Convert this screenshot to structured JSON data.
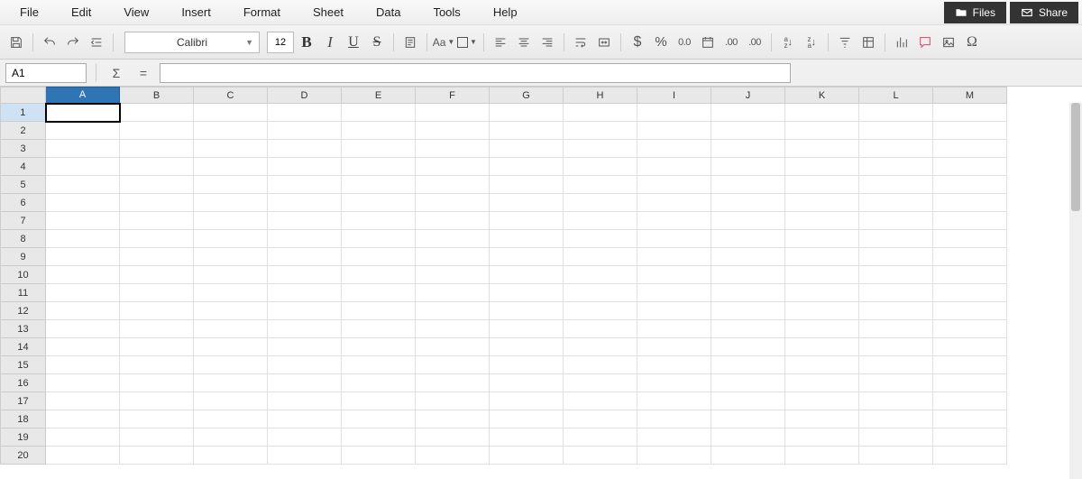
{
  "menu": {
    "items": [
      "File",
      "Edit",
      "View",
      "Insert",
      "Format",
      "Sheet",
      "Data",
      "Tools",
      "Help"
    ],
    "files_label": "Files",
    "share_label": "Share"
  },
  "toolbar": {
    "font_name": "Calibri",
    "font_size": "12",
    "bold": "B",
    "italic": "I",
    "underline": "U",
    "strike": "S",
    "aa": "Aa",
    "currency": "$",
    "percent": "%",
    "number_fmt": "0.0",
    "add_dec": ".00",
    "rem_dec": ".00",
    "sort_asc": "a↓",
    "sort_desc": "z↓",
    "omega": "Ω"
  },
  "formula": {
    "cell_ref": "A1",
    "sigma": "Σ",
    "equals": "=",
    "input": ""
  },
  "grid": {
    "columns": [
      "A",
      "B",
      "C",
      "D",
      "E",
      "F",
      "G",
      "H",
      "I",
      "J",
      "K",
      "L",
      "M"
    ],
    "rows": [
      "1",
      "2",
      "3",
      "4",
      "5",
      "6",
      "7",
      "8",
      "9",
      "10",
      "11",
      "12",
      "13",
      "14",
      "15",
      "16",
      "17",
      "18",
      "19",
      "20"
    ],
    "selected_col": "A",
    "selected_row": "1"
  }
}
